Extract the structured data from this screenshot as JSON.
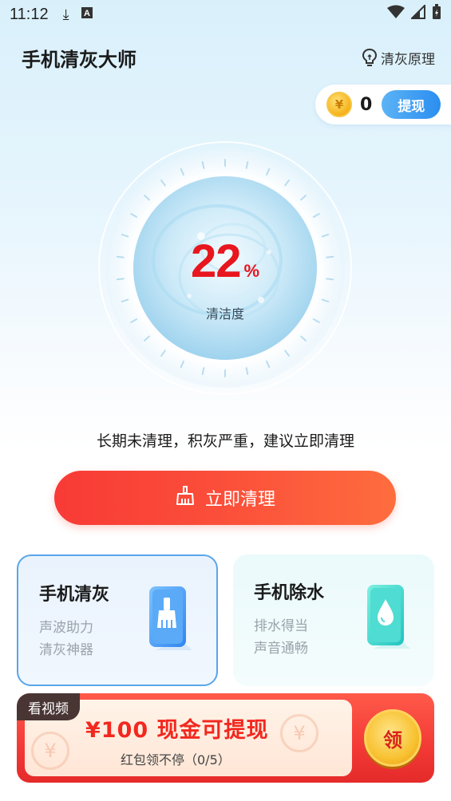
{
  "status_bar": {
    "time": "11:12"
  },
  "header": {
    "title": "手机清灰大师",
    "principle_label": "清灰原理"
  },
  "wallet": {
    "coin_symbol": "¥",
    "coin_count": "0",
    "withdraw_label": "提现"
  },
  "gauge": {
    "value": "22",
    "unit": "%",
    "label": "清洁度",
    "level_percent": 22
  },
  "advice": "长期未清理，积灰严重，建议立即清理",
  "clean_button_label": "立即清理",
  "cards": [
    {
      "title": "手机清灰",
      "lines": [
        "声波助力",
        "清灰神器"
      ],
      "icon": "brush-phone-icon"
    },
    {
      "title": "手机除水",
      "lines": [
        "排水得当",
        "声音通畅"
      ],
      "icon": "water-drop-phone-icon"
    }
  ],
  "promo": {
    "tag": "看视频",
    "title": "¥100 现金可提现",
    "subtitle": "红包领不停（0/5）",
    "claim_label": "领"
  },
  "colors": {
    "accent_red": "#f33a36",
    "accent_blue": "#2b8ef0",
    "percent_red": "#e8161e"
  }
}
